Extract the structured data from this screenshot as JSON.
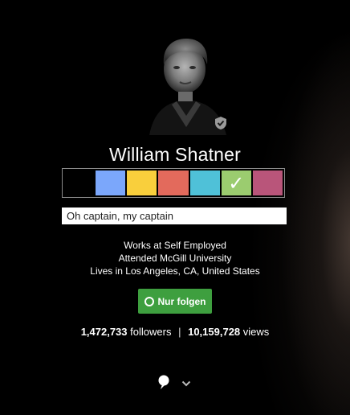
{
  "profile": {
    "name": "William Shatner",
    "tagline": "Oh captain, my captain",
    "works_at": "Works at Self Employed",
    "attended": "Attended McGill University",
    "lives_in": "Lives in Los Angeles, CA, United States",
    "follow_label": "Nur folgen",
    "followers_count": "1,472,733",
    "followers_label": "followers",
    "separator": "|",
    "views_count": "10,159,728",
    "views_label": "views",
    "verified_icon": "shield-check-icon"
  },
  "swatches": [
    {
      "color": "#000000",
      "selected": false
    },
    {
      "color": "#7ba7fb",
      "selected": false
    },
    {
      "color": "#f9cf3c",
      "selected": false
    },
    {
      "color": "#e36a5c",
      "selected": false
    },
    {
      "color": "#4fc1d8",
      "selected": false
    },
    {
      "color": "#9bcc6f",
      "selected": true,
      "mark": "✓"
    },
    {
      "color": "#b9557a",
      "selected": false
    }
  ],
  "colors": {
    "follow_button": "#3e9f3f",
    "background": "#000000"
  },
  "bottom": {
    "icons": [
      "comment-icon",
      "chevron-down-icon"
    ]
  }
}
